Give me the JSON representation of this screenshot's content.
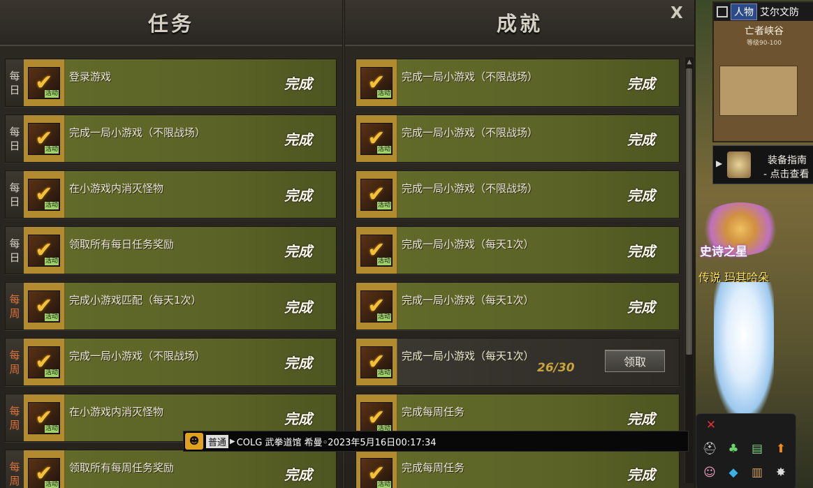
{
  "quests": {
    "title": "任务",
    "rows": [
      {
        "tag": [
          "每",
          "日"
        ],
        "weekly": false,
        "desc": "登录游戏",
        "status": "完成",
        "icon_tag": "活动"
      },
      {
        "tag": [
          "每",
          "日"
        ],
        "weekly": false,
        "desc": "完成一局小游戏（不限战场）",
        "status": "完成",
        "icon_tag": "活动"
      },
      {
        "tag": [
          "每",
          "日"
        ],
        "weekly": false,
        "desc": "在小游戏内消灭怪物",
        "status": "完成",
        "icon_tag": "活动"
      },
      {
        "tag": [
          "每",
          "日"
        ],
        "weekly": false,
        "desc": "领取所有每日任务奖励",
        "status": "完成",
        "icon_tag": "活动"
      },
      {
        "tag": [
          "每",
          "周"
        ],
        "weekly": true,
        "desc": "完成小游戏匹配（每天1次）",
        "status": "完成",
        "icon_tag": "活动"
      },
      {
        "tag": [
          "每",
          "周"
        ],
        "weekly": true,
        "desc": "完成一局小游戏（不限战场）",
        "status": "完成",
        "icon_tag": "活动"
      },
      {
        "tag": [
          "每",
          "周"
        ],
        "weekly": true,
        "desc": "在小游戏内消灭怪物",
        "status": "完成",
        "icon_tag": "活动"
      },
      {
        "tag": [
          "每",
          "周"
        ],
        "weekly": true,
        "desc": "领取所有每周任务奖励",
        "status": "完成",
        "icon_tag": "活动"
      }
    ]
  },
  "achievements": {
    "title": "成就",
    "close_glyph": "X",
    "rows": [
      {
        "desc": "完成一局小游戏（不限战场）",
        "status": "完成",
        "icon_tag": "活动"
      },
      {
        "desc": "完成一局小游戏（不限战场）",
        "status": "完成",
        "icon_tag": "活动"
      },
      {
        "desc": "完成一局小游戏（不限战场）",
        "status": "完成",
        "icon_tag": "活动"
      },
      {
        "desc": "完成一局小游戏（每天1次）",
        "status": "完成",
        "icon_tag": "活动"
      },
      {
        "desc": "完成一局小游戏（每天1次）",
        "status": "完成",
        "icon_tag": "活动"
      },
      {
        "desc": "完成一局小游戏（每天1次）",
        "status": "",
        "progress": "26/30",
        "button": "领取",
        "icon_tag": "活动"
      },
      {
        "desc": "完成每周任务",
        "status": "完成",
        "icon_tag": "活动"
      },
      {
        "desc": "完成每周任务",
        "status": "完成",
        "icon_tag": "活动"
      }
    ]
  },
  "chat": {
    "channel": "普通",
    "message": "COLG 武拳道馆 希曼◦2023年5月16日00:17:34"
  },
  "side": {
    "minimap": {
      "tab_active": "人物",
      "tab_other": "艾尔文防",
      "zone": "亡者峡谷",
      "level": "等级90-100"
    },
    "guide": {
      "title": "装备指南",
      "subtitle": "- 点击查看"
    },
    "badge_name": "史诗之星",
    "legend": "传说 玛其哈朵"
  },
  "colors": {
    "row_green": "#5e6628",
    "icon_frame_gold": "#b28a2f",
    "weekly_orange": "#e0713a",
    "progress_gold": "#c9a43c"
  }
}
